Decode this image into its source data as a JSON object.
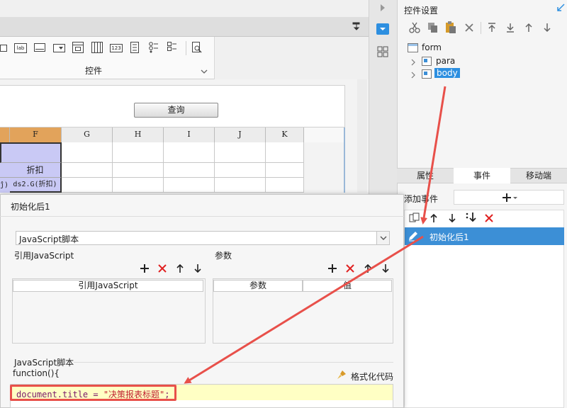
{
  "toolbar": {
    "section_label": "控件",
    "icons": [
      "textbox-icon",
      "label-icon",
      "textarea-icon",
      "combobox-icon",
      "datepicker-icon",
      "calendar-icon",
      "number-icon",
      "radiogroup-icon",
      "checkboxgroup-icon",
      "tree-icon",
      "search-icon"
    ]
  },
  "canvas": {
    "query_button": "查询",
    "columns": [
      "F",
      "G",
      "H",
      "I",
      "J",
      "K"
    ],
    "cell_discount": "折扣",
    "cell_partial": "ĵ)",
    "cell_formula": "ds2.G(折扣)"
  },
  "right_panel": {
    "title": "控件设置",
    "tree": {
      "root": "form",
      "children": [
        "para",
        "body"
      ]
    },
    "tabs": [
      "属性",
      "事件",
      "移动端"
    ],
    "add_event_label": "添加事件",
    "event_item": "初始化后1"
  },
  "dialog": {
    "title": "初始化后1",
    "type_select": "JavaScript脚本",
    "ref_js_label": "引用JavaScript",
    "params_label": "参数",
    "ref_js_col": "引用JavaScript",
    "params_cols": [
      "参数",
      "值"
    ],
    "script_label": "JavaScript脚本",
    "function_header": "function(){",
    "format_button": "格式化代码",
    "code": {
      "prefix": "document.title = ",
      "string": "\"决策报表标题\"",
      "suffix": ";"
    }
  },
  "colors": {
    "selection_blue": "#3c8fd6",
    "header_purple": "#c9c9f5",
    "annotation_red": "#e8504a",
    "code_bg": "#ffffc4",
    "delete_red": "#e02020"
  }
}
